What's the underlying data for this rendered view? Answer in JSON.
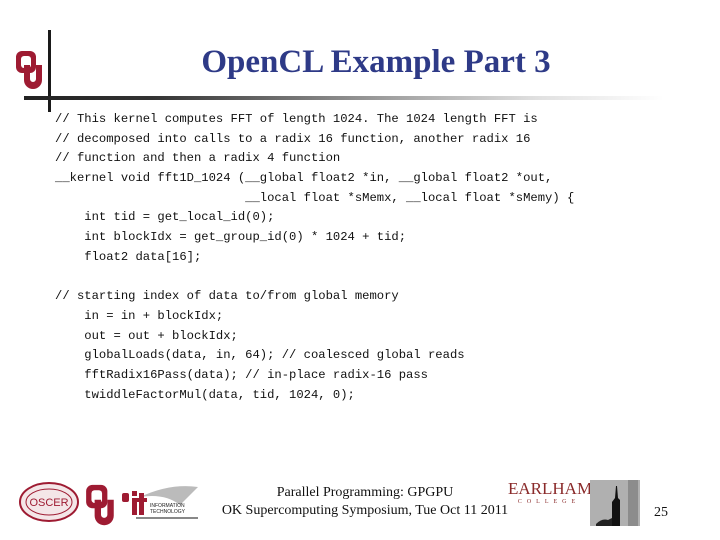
{
  "slide": {
    "title": "OpenCL Example Part 3",
    "code_lines": [
      "// This kernel computes FFT of length 1024. The 1024 length FFT is",
      "// decomposed into calls to a radix 16 function, another radix 16",
      "// function and then a radix 4 function",
      "__kernel void fft1D_1024 (__global float2 *in, __global float2 *out,",
      "                          __local float *sMemx, __local float *sMemy) {",
      "    int tid = get_local_id(0);",
      "    int blockIdx = get_group_id(0) * 1024 + tid;",
      "    float2 data[16];",
      "",
      "// starting index of data to/from global memory",
      "    in = in + blockIdx;",
      "    out = out + blockIdx;",
      "    globalLoads(data, in, 64); // coalesced global reads",
      "    fftRadix16Pass(data); // in-place radix-16 pass",
      "    twiddleFactorMul(data, tid, 1024, 0);"
    ]
  },
  "footer": {
    "line1": "Parallel Programming: GPGPU",
    "line2": "OK Supercomputing Symposium, Tue Oct 11 2011",
    "page_number": "25",
    "logos": {
      "oscer": "OSCER",
      "it_label_1": "INFORMATION",
      "it_label_2": "TECHNOLOGY",
      "earlham_word": "EARLHAM",
      "earlham_sub": "COLLEGE"
    }
  },
  "colors": {
    "title": "#2e3a87",
    "ou_crimson": "#9e1b32"
  }
}
